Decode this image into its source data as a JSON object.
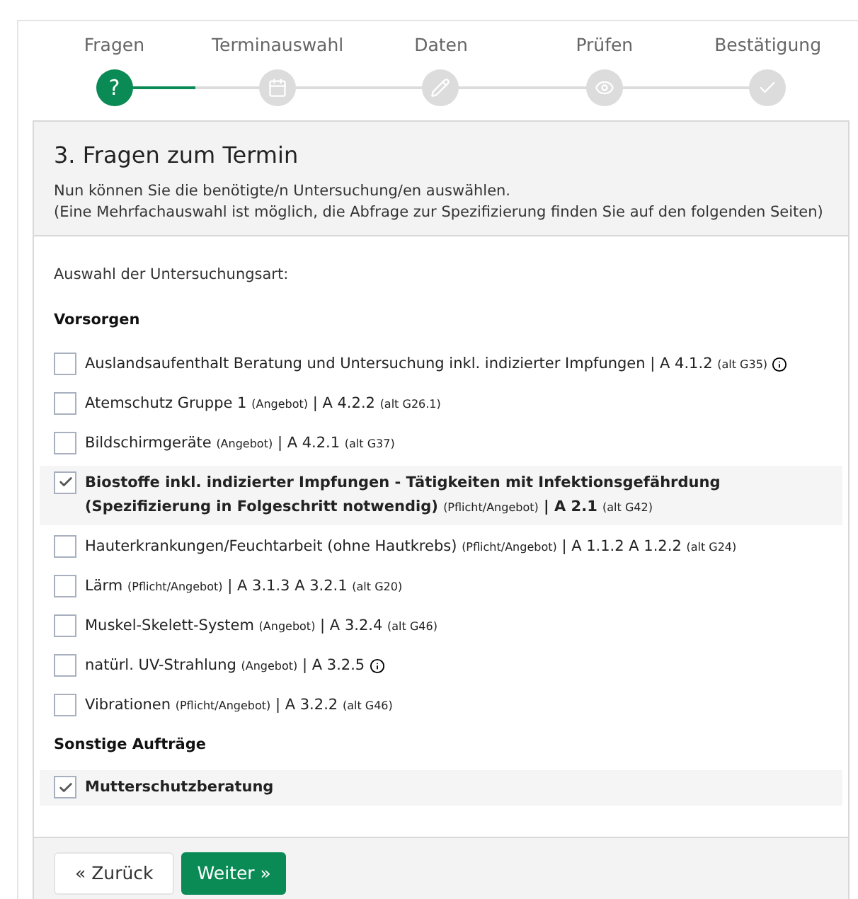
{
  "steps": [
    {
      "label": "Fragen",
      "kind": "question",
      "symbol": "?",
      "selected": true
    },
    {
      "label": "Terminauswahl",
      "kind": "calendar",
      "selected": false
    },
    {
      "label": "Daten",
      "kind": "pencil",
      "selected": false
    },
    {
      "label": "Prüfen",
      "kind": "eye",
      "selected": false
    },
    {
      "label": "Bestätigung",
      "kind": "check",
      "selected": false
    }
  ],
  "header": {
    "title": "3. Fragen zum Termin",
    "lines": [
      "Nun können Sie die benötigte/n Untersuchung/en auswählen.",
      "(Eine Mehrfachauswahl ist möglich, die Abfrage zur Spezifizierung finden Sie auf den folgenden Seiten)"
    ]
  },
  "intro": "Auswahl der Untersuchungsart:",
  "groups": [
    {
      "title": "Vorsorgen",
      "items": [
        {
          "label": "Auslandsaufenthalt Beratung und Untersuchung inkl. indizierter Impfungen",
          "code": "| A 4.1.2",
          "alt": "(alt G35)",
          "info": true,
          "checked": false
        },
        {
          "label": "Atemschutz Gruppe 1",
          "note": "(Angebot)",
          "code": "| A 4.2.2",
          "alt": "(alt G26.1)",
          "info": false,
          "checked": false
        },
        {
          "label": "Bildschirmgeräte",
          "note": "(Angebot)",
          "code": "| A 4.2.1",
          "alt": "(alt G37)",
          "info": false,
          "checked": false
        },
        {
          "label": "Biostoffe inkl. indizierter Impfungen - Tätigkeiten mit Infektionsgefährdung (Spezifizierung in Folgeschritt notwendig)",
          "note": "(Pflicht/Angebot)",
          "code": "| A 2.1",
          "alt": "(alt G42)",
          "info": false,
          "checked": true
        },
        {
          "label": "Hauterkrankungen/Feuchtarbeit (ohne Hautkrebs)",
          "note": "(Pflicht/Angebot)",
          "code": "| A 1.1.2 A 1.2.2",
          "alt": "(alt G24)",
          "info": false,
          "checked": false
        },
        {
          "label": "Lärm",
          "note": "(Pflicht/Angebot)",
          "code": "| A 3.1.3 A 3.2.1",
          "alt": "(alt G20)",
          "info": false,
          "checked": false
        },
        {
          "label": "Muskel-Skelett-System",
          "note": "(Angebot)",
          "code": "| A 3.2.4",
          "alt": "(alt G46)",
          "info": false,
          "checked": false
        },
        {
          "label": "natürl. UV-Strahlung",
          "note": "(Angebot)",
          "code": "| A 3.2.5",
          "info": true,
          "checked": false
        },
        {
          "label": "Vibrationen",
          "note": "(Pflicht/Angebot)",
          "code": "| A 3.2.2",
          "alt": "(alt G46)",
          "info": false,
          "checked": false
        }
      ]
    },
    {
      "title": "Sonstige Aufträge",
      "items": [
        {
          "label": "Mutterschutzberatung",
          "info": false,
          "checked": true
        }
      ]
    }
  ],
  "buttons": {
    "back": "« Zurück",
    "next": "Weiter »"
  }
}
